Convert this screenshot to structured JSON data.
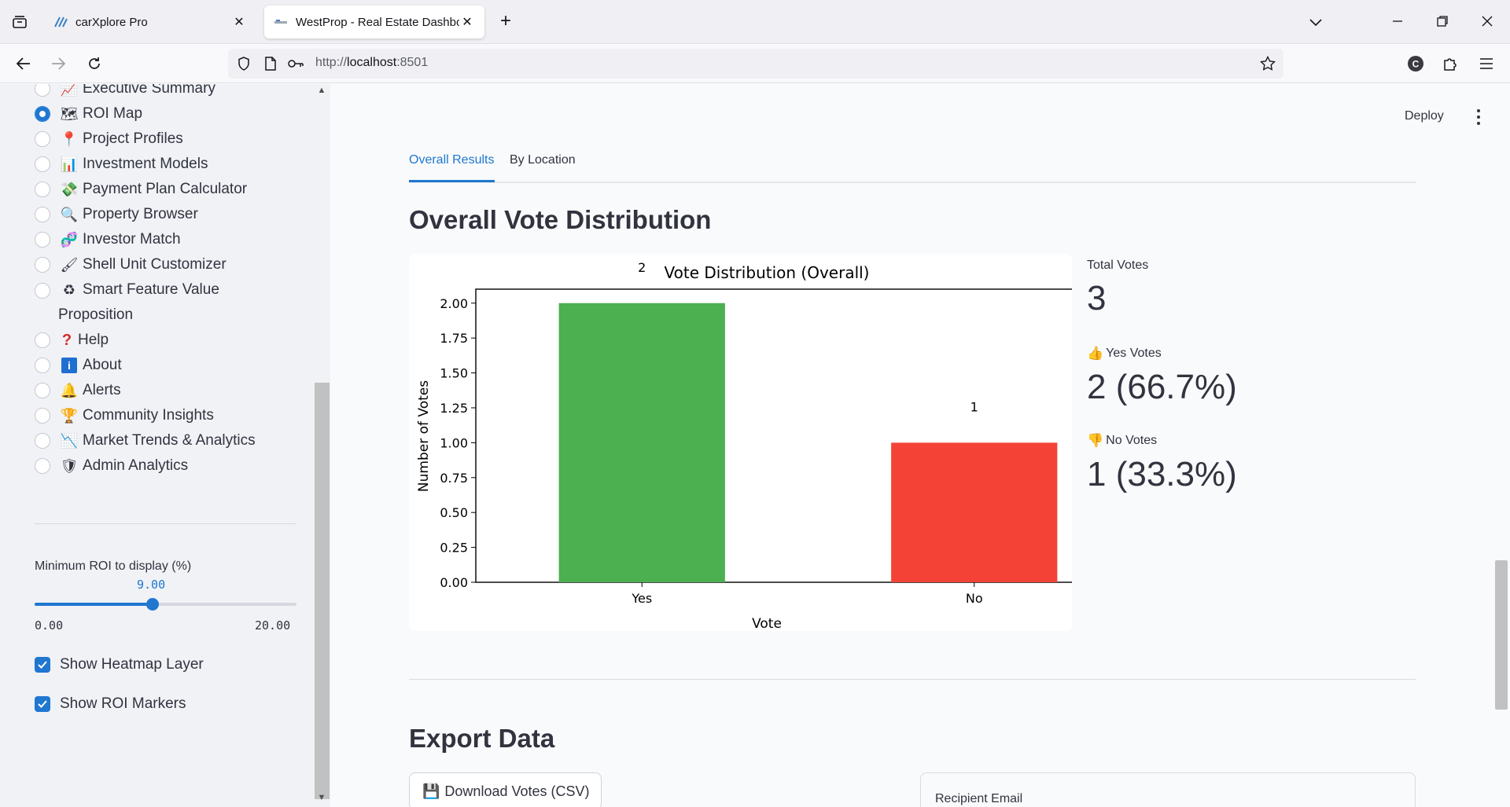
{
  "browser": {
    "tabs": [
      {
        "title": "carXplore Pro",
        "active": false
      },
      {
        "title": "WestProp - Real Estate Dashboard",
        "active": true
      }
    ],
    "url_prefix": "http://",
    "url_host": "localhost",
    "url_suffix": ":8501"
  },
  "sidebar": {
    "items": [
      {
        "label": "Executive Summary",
        "icon": "chart-up-icon",
        "emoji": "📈",
        "selected": false
      },
      {
        "label": "ROI Map",
        "icon": "map-icon",
        "emoji": "🗺",
        "selected": true
      },
      {
        "label": "Project Profiles",
        "icon": "pin-icon",
        "emoji": "📍",
        "selected": false
      },
      {
        "label": "Investment Models",
        "icon": "bar-chart-icon",
        "emoji": "📊",
        "selected": false
      },
      {
        "label": "Payment Plan Calculator",
        "icon": "money-icon",
        "emoji": "💸",
        "selected": false
      },
      {
        "label": "Property Browser",
        "icon": "magnifier-icon",
        "emoji": "🔍",
        "selected": false
      },
      {
        "label": "Investor Match",
        "icon": "dna-icon",
        "emoji": "🧬",
        "selected": false
      },
      {
        "label": "Shell Unit Customizer",
        "icon": "brush-icon",
        "emoji": "🖌",
        "selected": false
      },
      {
        "label": "Smart Feature Value Proposition",
        "label_line1": "Smart Feature Value",
        "label_line2": "Proposition",
        "icon": "recycle-icon",
        "emoji": "♻",
        "selected": false
      },
      {
        "label": "Help",
        "icon": "question-icon",
        "emoji": "❓",
        "selected": false
      },
      {
        "label": "About",
        "icon": "info-icon",
        "emoji": "ℹ",
        "selected": false
      },
      {
        "label": "Alerts",
        "icon": "bell-icon",
        "emoji": "🔔",
        "selected": false
      },
      {
        "label": "Community Insights",
        "icon": "trophy-icon",
        "emoji": "🏆",
        "selected": false
      },
      {
        "label": "Market Trends & Analytics",
        "icon": "chart-down-icon",
        "emoji": "📉",
        "selected": false
      },
      {
        "label": "Admin Analytics",
        "icon": "shield-icon",
        "emoji": "🛡",
        "selected": false
      }
    ],
    "slider": {
      "label": "Minimum ROI to display (%)",
      "value": "9.00",
      "min": "0.00",
      "max": "20.00",
      "fraction": 0.45
    },
    "checkboxes": [
      {
        "label": "Show Heatmap Layer",
        "checked": true
      },
      {
        "label": "Show ROI Markers",
        "checked": true
      }
    ]
  },
  "header": {
    "deploy_label": "Deploy"
  },
  "main": {
    "tabs": [
      {
        "label": "Overall Results",
        "active": true
      },
      {
        "label": "By Location",
        "active": false
      }
    ],
    "section_title": "Overall Vote Distribution",
    "metrics": [
      {
        "label": "Total Votes",
        "value": "3",
        "icon": ""
      },
      {
        "label": "Yes Votes",
        "value": "2 (66.7%)",
        "icon": "thumbs-up-icon"
      },
      {
        "label": "No Votes",
        "value": "1 (33.3%)",
        "icon": "thumbs-down-icon"
      }
    ],
    "export_title": "Export Data",
    "download_label": "Download Votes (CSV)",
    "recipient_label": "Recipient Email"
  },
  "chart_data": {
    "type": "bar",
    "title": "Vote Distribution (Overall)",
    "categories": [
      "Yes",
      "No"
    ],
    "values": [
      2,
      1
    ],
    "data_labels": [
      "2",
      "1"
    ],
    "colors": [
      "#4caf50",
      "#f44336"
    ],
    "xlabel": "Vote",
    "ylabel": "Number of Votes",
    "ylim": [
      0,
      2.1
    ],
    "yticks": [
      "0.00",
      "0.25",
      "0.50",
      "0.75",
      "1.00",
      "1.25",
      "1.50",
      "1.75",
      "2.00"
    ],
    "grid": false
  }
}
